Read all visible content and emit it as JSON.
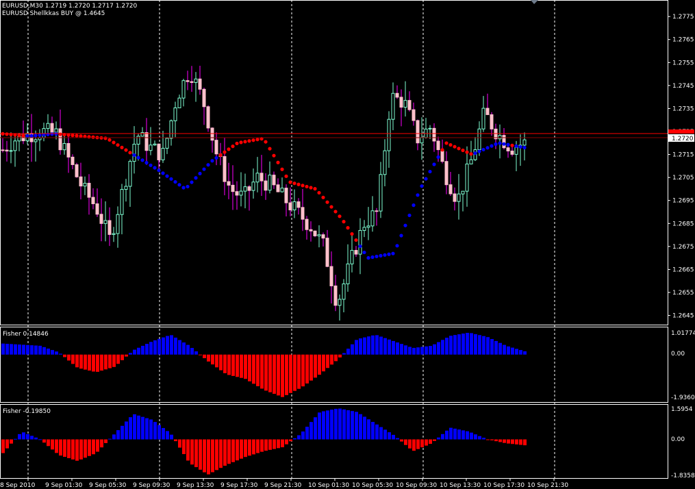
{
  "header": {
    "line1": "EURUSD,M30  1.2719 1.2720 1.2717 1.2720",
    "line2": "EURUSD Shellkkas BUY @ 1.4645"
  },
  "price_scale": {
    "labels": [
      "1.2775",
      "1.2765",
      "1.2755",
      "1.2745",
      "1.2735",
      "1.2725",
      "1.2715",
      "1.2705",
      "1.2695",
      "1.2685",
      "1.2675",
      "1.2665",
      "1.2655",
      "1.2645"
    ],
    "current": "1.2720"
  },
  "indicator1": {
    "title": "Fisher 0.14846",
    "labels": [
      "1.01774",
      "0.00",
      "-1.93605"
    ]
  },
  "indicator2": {
    "title": "Fisher -0.19850",
    "labels": [
      "1.5954",
      "0.00",
      "-1.83581"
    ]
  },
  "time_axis": {
    "labels": [
      "8 Sep 2010",
      "9 Sep 01:30",
      "9 Sep 05:30",
      "9 Sep 09:30",
      "9 Sep 13:30",
      "9 Sep 17:30",
      "9 Sep 21:30",
      "10 Sep 01:30",
      "10 Sep 05:30",
      "10 Sep 09:30",
      "10 Sep 13:30",
      "10 Sep 17:30",
      "10 Sep 21:30"
    ]
  },
  "colors": {
    "background": "#000000",
    "frame": "#ffffff",
    "bull": "#7fffd4",
    "bear": "#ffc0cb",
    "wick_bull": "#7fffd4",
    "wick_bear": "#ff00ff",
    "dot_up": "#0000ff",
    "dot_down": "#ff0000",
    "hist_pos": "#0000ff",
    "hist_neg": "#ff0000",
    "price_line": "#ff0000",
    "grid": "#ffffff"
  },
  "chart_data": [
    {
      "type": "candlestick",
      "title": "EURUSD,M30",
      "x": [
        "8 Sep 2010",
        "9 Sep 01:30",
        "9 Sep 05:30",
        "9 Sep 09:30",
        "9 Sep 13:30",
        "9 Sep 17:30",
        "9 Sep 21:30",
        "10 Sep 01:30",
        "10 Sep 05:30",
        "10 Sep 09:30",
        "10 Sep 13:30",
        "10 Sep 17:30",
        "10 Sep 21:30"
      ],
      "ylim": [
        1.2641,
        1.2781
      ],
      "close_path": [
        1.2717,
        1.2722,
        1.2724,
        1.2725,
        1.2724,
        1.2712,
        1.27,
        1.2692,
        1.2678,
        1.27,
        1.2724,
        1.2718,
        1.2715,
        1.274,
        1.2752,
        1.2738,
        1.2715,
        1.27,
        1.2696,
        1.2705,
        1.2702,
        1.2696,
        1.269,
        1.2684,
        1.2675,
        1.265,
        1.2668,
        1.2685,
        1.269,
        1.274,
        1.2738,
        1.2722,
        1.2727,
        1.2708,
        1.2695,
        1.2712,
        1.2733,
        1.2724,
        1.2718,
        1.272
      ],
      "sar_levels": [
        1.2724,
        1.2723,
        1.2724,
        1.2723,
        1.2722,
        1.2715,
        1.2708,
        1.27,
        1.2712,
        1.272,
        1.2722,
        1.2703,
        1.27,
        1.2687,
        1.267,
        1.2672,
        1.27,
        1.272,
        1.2715,
        1.272,
        1.2718
      ],
      "current_price": 1.272
    },
    {
      "type": "bar",
      "title": "Fisher 0.14846",
      "ylim": [
        -1.93605,
        1.01774
      ],
      "values": [
        0.5,
        0.45,
        0.4,
        0.1,
        -0.6,
        -0.8,
        -0.55,
        0.2,
        0.6,
        0.9,
        0.4,
        -0.3,
        -0.9,
        -1.1,
        -1.6,
        -1.93,
        -1.5,
        -0.9,
        -0.2,
        0.7,
        0.9,
        0.6,
        0.3,
        0.4,
        0.85,
        1.0,
        0.8,
        0.4,
        0.15
      ]
    },
    {
      "type": "bar",
      "title": "Fisher -0.19850",
      "ylim": [
        -1.83581,
        1.5954
      ],
      "values": [
        -0.7,
        0.4,
        0.0,
        -0.8,
        -1.1,
        -0.7,
        0.3,
        1.3,
        1.0,
        0.3,
        -1.2,
        -1.8,
        -1.3,
        -0.9,
        -0.6,
        -0.4,
        0.3,
        1.4,
        1.59,
        1.4,
        0.8,
        0.2,
        -0.6,
        -0.2,
        0.6,
        0.4,
        0.0,
        -0.2,
        -0.3
      ]
    }
  ]
}
